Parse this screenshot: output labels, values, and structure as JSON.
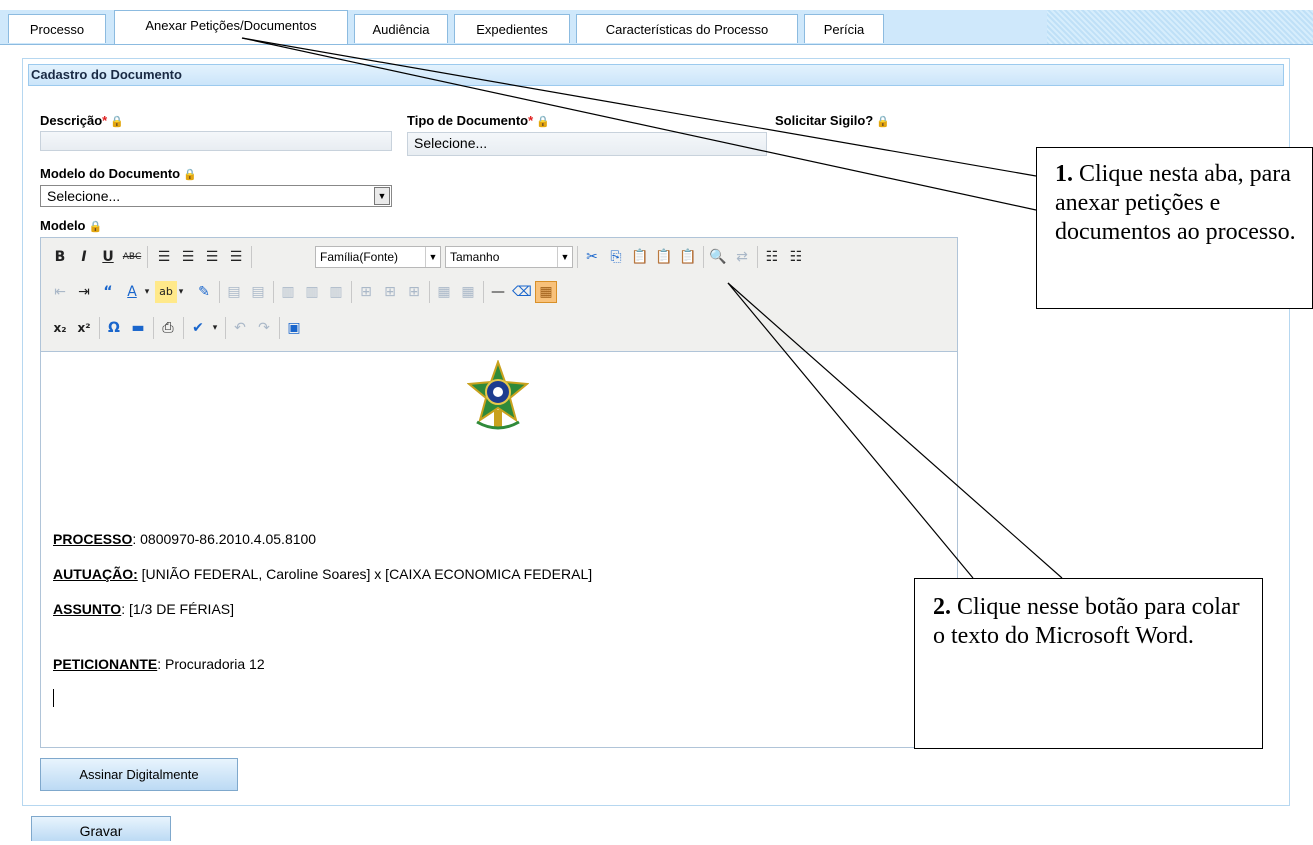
{
  "tabs": [
    {
      "label": "Processo",
      "active": false
    },
    {
      "label": "Anexar Petições/Documentos",
      "active": true
    },
    {
      "label": "Audiência",
      "active": false
    },
    {
      "label": "Expedientes",
      "active": false
    },
    {
      "label": "Características do Processo",
      "active": false
    },
    {
      "label": "Perícia",
      "active": false
    }
  ],
  "panel": {
    "title": "Cadastro do Documento"
  },
  "form": {
    "descricao": {
      "label": "Descrição",
      "required": "*",
      "value": ""
    },
    "tipo": {
      "label": "Tipo de Documento",
      "required": "*",
      "value": "Selecione..."
    },
    "sigilo": {
      "label": "Solicitar Sigilo?"
    },
    "modelo_doc": {
      "label": "Modelo do Documento",
      "value": "Selecione..."
    },
    "modelo": {
      "label": "Modelo"
    }
  },
  "toolbar": {
    "font_family": "Família(Fonte)",
    "font_size": "Tamanho"
  },
  "document": {
    "processo_label": "PROCESSO",
    "processo_value": ": 0800970-86.2010.4.05.8100",
    "autuacao_label": "AUTUAÇÃO:",
    "autuacao_value": " [UNIÃO FEDERAL, Caroline Soares] x [CAIXA ECONOMICA FEDERAL]",
    "assunto_label": "ASSUNTO",
    "assunto_value": ": [1/3 DE FÉRIAS]",
    "peticionante_label": "PETICIONANTE",
    "peticionante_value": ": Procuradoria 12"
  },
  "buttons": {
    "assinar": "Assinar Digitalmente",
    "gravar": "Gravar"
  },
  "callouts": {
    "c1_num": "1.",
    "c1_text": " Clique nesta aba, para anexar petições e documentos ao processo.",
    "c2_num": "2.",
    "c2_text": " Clique nesse botão para colar o texto do Microsoft Word."
  },
  "colors": {
    "tab_bar": "#cfe8fb",
    "panel_head": "#cbe5fa",
    "highlight": "#f8c17a"
  }
}
